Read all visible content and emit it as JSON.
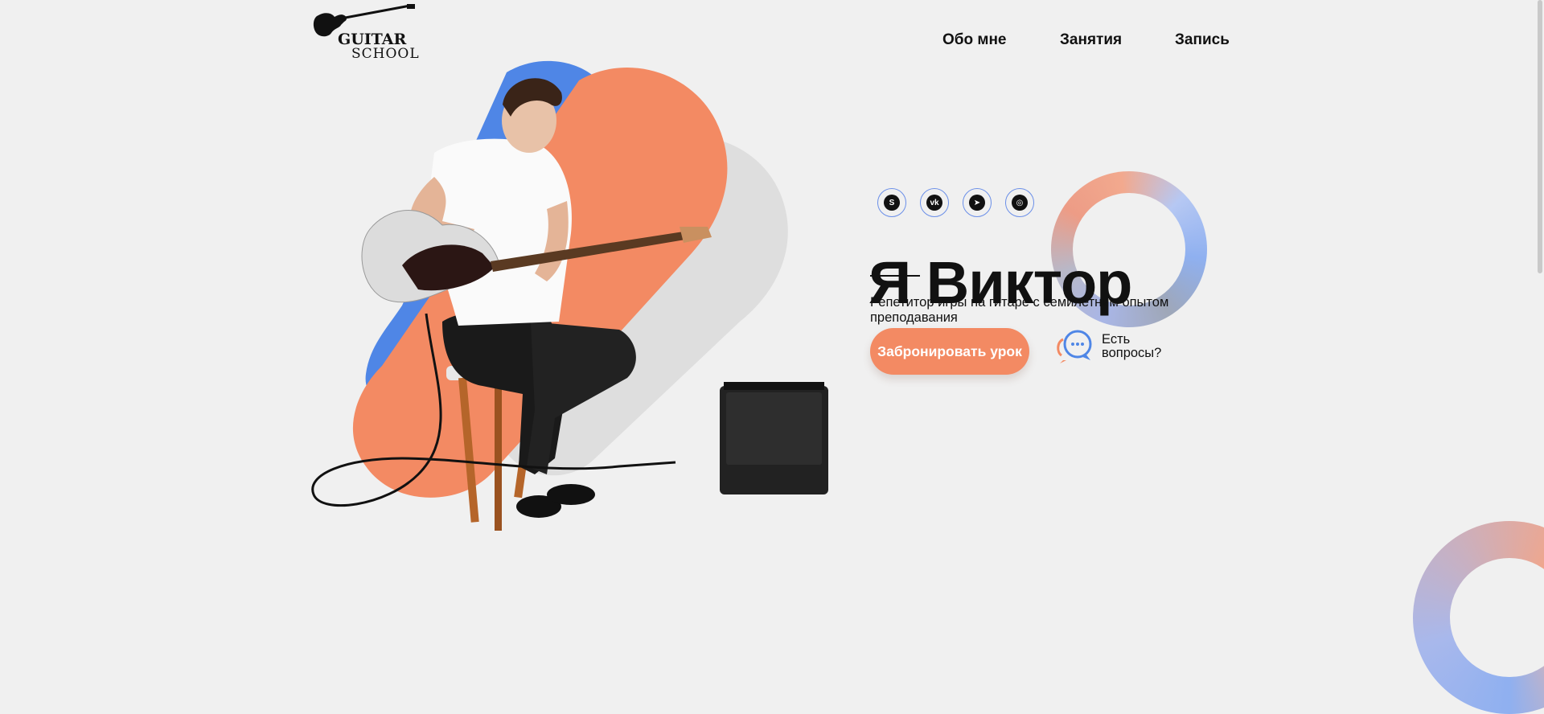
{
  "logo": {
    "line1": "GUITAR",
    "line2": "SCHOOL"
  },
  "nav": [
    {
      "label": "Обо мне"
    },
    {
      "label": "Занятия"
    },
    {
      "label": "Запись"
    }
  ],
  "hero": {
    "title": "Я Виктор",
    "subtitle": "Репетитор игры на гитаре с семилетним опытом преподавания",
    "cta_label": "Забронировать урок",
    "questions_label": "Есть вопросы?"
  },
  "socials": [
    {
      "name": "skype-icon",
      "glyph": "S"
    },
    {
      "name": "vk-icon",
      "glyph": "vk"
    },
    {
      "name": "telegram-icon",
      "glyph": "➤"
    },
    {
      "name": "instagram-icon",
      "glyph": "◎"
    }
  ],
  "colors": {
    "accent_orange": "#f38a63",
    "accent_blue": "#4f86e6",
    "background": "#f0f0f0"
  }
}
